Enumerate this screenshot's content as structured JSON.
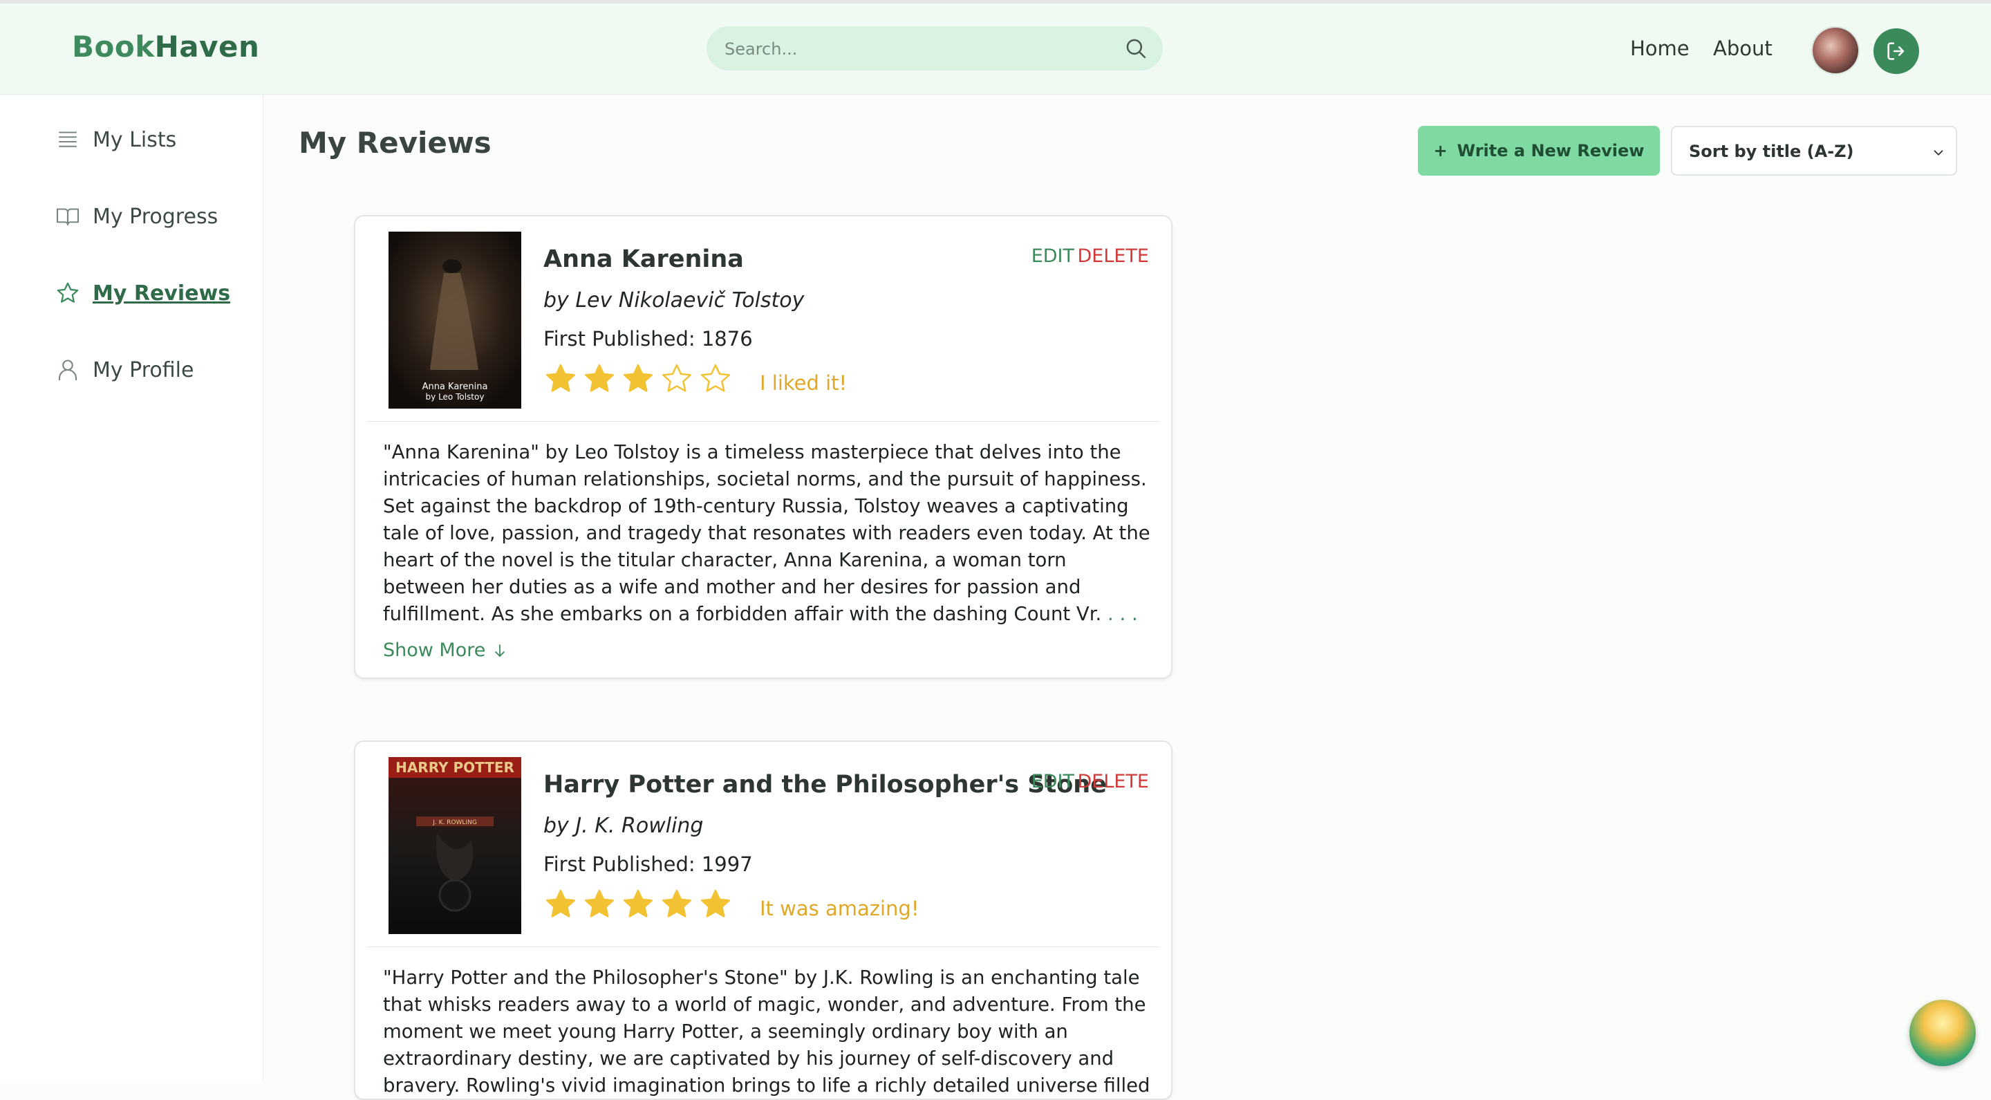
{
  "header": {
    "logo_part1": "Book",
    "logo_part2": "Haven",
    "search_placeholder": "Search...",
    "nav": [
      "Home",
      "About"
    ],
    "search_icon": "search-icon",
    "logout_icon": "logout-icon"
  },
  "sidebar": {
    "items": [
      {
        "label": "My Lists",
        "icon": "list-icon"
      },
      {
        "label": "My Progress",
        "icon": "open-book-icon"
      },
      {
        "label": "My Reviews",
        "icon": "star-outline-icon",
        "active": true
      },
      {
        "label": "My Profile",
        "icon": "user-icon"
      }
    ]
  },
  "main": {
    "title": "My Reviews",
    "write_button": "Write a New Review",
    "write_button_icon": "+",
    "sort_value": "Sort by title (A-Z)"
  },
  "reviews": [
    {
      "title": "Anna Karenina",
      "author": "by Lev Nikolaevič Tolstoy",
      "published": "First Published: 1876",
      "rating": 3,
      "max_rating": 5,
      "rating_text": "I liked it!",
      "edit": "EDIT",
      "delete": "DELETE",
      "cover_text_1": "Anna Karenina",
      "cover_text_2": "by Leo Tolstoy",
      "text": "\"Anna Karenina\" by Leo Tolstoy is a timeless masterpiece that delves into the intricacies of human relationships, societal norms, and the pursuit of happiness. Set against the backdrop of 19th-century Russia, Tolstoy weaves a captivating tale of love, passion, and tragedy that resonates with readers even today. At the heart of the novel is the titular character, Anna Karenina, a woman torn between her duties as a wife and mother and her desires for passion and fulfillment. As she embarks on a forbidden affair with the dashing Count Vr.",
      "ellipsis": " . . .",
      "show_more": "Show More"
    },
    {
      "title": "Harry Potter and the Philosopher's Stone",
      "author": "by J. K. Rowling",
      "published": "First Published: 1997",
      "rating": 5,
      "max_rating": 5,
      "rating_text": "It was amazing!",
      "edit": "EDIT",
      "delete": "DELETE",
      "cover_text_1": "HARRY POTTER",
      "cover_text_2": "J. K. ROWLING",
      "text": "\"Harry Potter and the Philosopher's Stone\" by J.K. Rowling is an enchanting tale that whisks readers away to a world of magic, wonder, and adventure. From the moment we meet young Harry Potter, a seemingly ordinary boy with an extraordinary destiny, we are captivated by his journey of self-discovery and bravery. Rowling's vivid imagination brings to life a richly detailed universe filled"
    }
  ],
  "colors": {
    "brand": "#3e8a5e",
    "accent_button": "#7fd9a3",
    "star": "#f2c233",
    "delete": "#d23a3a"
  }
}
